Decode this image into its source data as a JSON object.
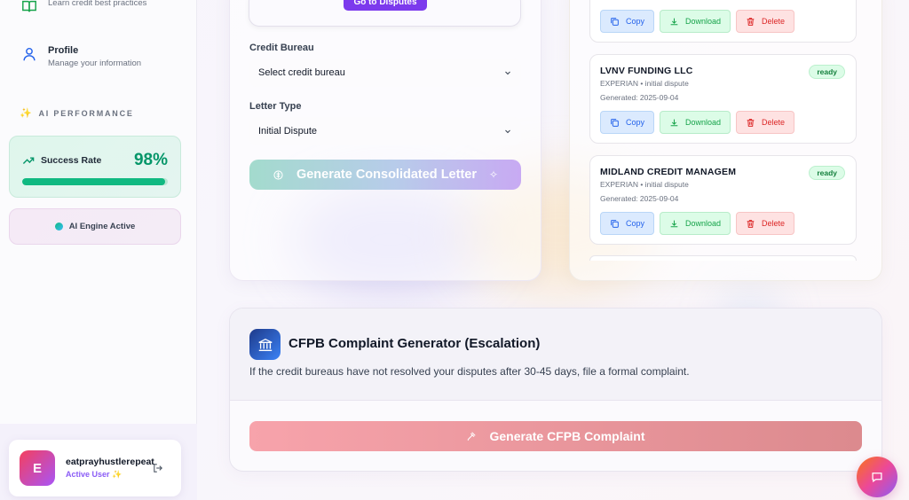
{
  "sidebar": {
    "items": [
      {
        "label": "",
        "sub": "Learn credit best practices",
        "icon": "book-icon"
      },
      {
        "label": "Profile",
        "sub": "Manage your information",
        "icon": "user-icon"
      }
    ],
    "ai_performance_title": "AI PERFORMANCE",
    "success_rate_label": "Success Rate",
    "success_rate_value": "98%",
    "success_rate_fraction": 0.98,
    "engine_status": "AI Engine Active",
    "user": {
      "initial": "E",
      "name": "eatprayhustlerepeat",
      "status": "Active User ✨"
    }
  },
  "form": {
    "goto_button": "Go to Disputes",
    "bureau_label": "Credit Bureau",
    "bureau_value": "Select credit bureau",
    "letter_type_label": "Letter Type",
    "letter_type_value": "Initial Dispute",
    "generate_button": "Generate Consolidated Letter"
  },
  "letters": {
    "actions": {
      "copy": "Copy",
      "download": "Download",
      "delete": "Delete"
    },
    "items": [
      {
        "name": "LVNV FUNDING LLC",
        "meta": "EXPERIAN • initial dispute",
        "date": "Generated: 2025-09-04",
        "status": "ready"
      },
      {
        "name": "MIDLAND CREDIT MANAGEM",
        "meta": "EXPERIAN • initial dispute",
        "date": "Generated: 2025-09-04",
        "status": "ready"
      }
    ]
  },
  "cfpb": {
    "title": "CFPB Complaint Generator (Escalation)",
    "description": "If the credit bureaus have not resolved your disputes after 30-45 days, file a formal complaint.",
    "button": "Generate CFPB Complaint"
  },
  "colors": {
    "accent": "#7c3aed",
    "success": "#10b981",
    "danger": "#dc2626",
    "info": "#2563eb"
  }
}
